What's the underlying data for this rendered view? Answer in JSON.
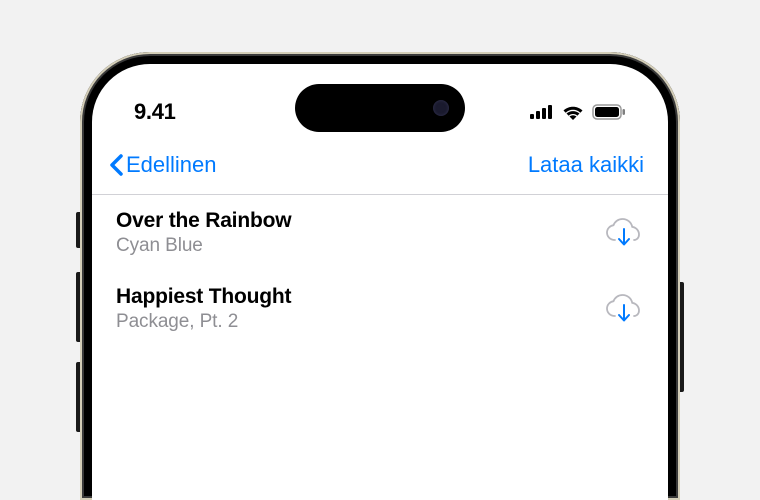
{
  "status": {
    "time": "9.41"
  },
  "nav": {
    "back_label": "Edellinen",
    "action_label": "Lataa kaikki"
  },
  "list": {
    "items": [
      {
        "title": "Over the Rainbow",
        "subtitle": "Cyan Blue"
      },
      {
        "title": "Happiest Thought",
        "subtitle": "Package, Pt. 2"
      }
    ]
  }
}
